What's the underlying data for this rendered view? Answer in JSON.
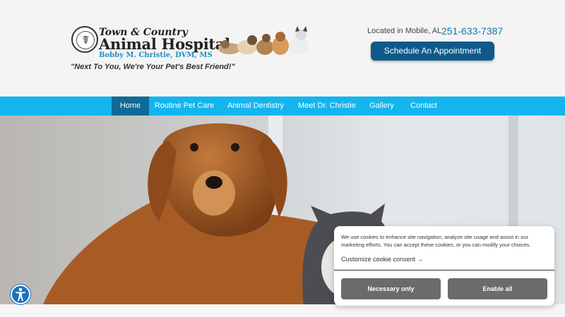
{
  "header": {
    "logo": {
      "line1": "Town & Country",
      "line2": "Animal Hospital",
      "line3": "Bobby M. Christie, DVM, MS"
    },
    "tagline": "\"Next To You, We're Your Pet's Best Friend!\"",
    "location": "Located in Mobile, AL",
    "phone": "251-633-7387",
    "schedule_label": "Schedule An Appointment"
  },
  "nav": {
    "items": [
      {
        "label": "Home",
        "active": true
      },
      {
        "label": "Routine Pet Care"
      },
      {
        "label": "Animal Dentistry"
      },
      {
        "label": "Meet Dr. Christie"
      },
      {
        "label": "Gallery"
      },
      {
        "label": "Contact"
      }
    ]
  },
  "cookie": {
    "text": "We use cookies to enhance site navigation, analyze site usage and assist in our marketing efforts. You can accept these cookies, or you can modify your choices.",
    "customize_label": "Customize cookie consent →",
    "necessary_label": "Necessary only",
    "enable_label": "Enable all"
  },
  "icons": {
    "accessibility": "accessibility-icon",
    "logo": "caduceus-seal-icon"
  },
  "colors": {
    "nav_bg": "#13b5ef",
    "nav_active": "#0e6a96",
    "cta": "#0f5a8a",
    "phone": "#1577a8",
    "cookie_btn": "#6b6b6b"
  }
}
